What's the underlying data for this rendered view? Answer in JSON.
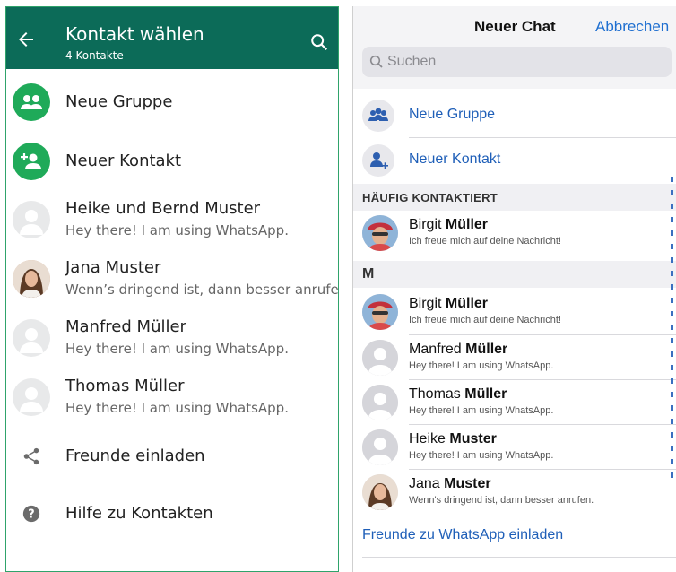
{
  "colors": {
    "android_header": "#0c6b58",
    "android_green": "#1faa59",
    "ios_blue": "#1f5fb8"
  },
  "android": {
    "title": "Kontakt wählen",
    "subtitle": "4 Kontakte",
    "actions": [
      {
        "label": "Neue Gruppe",
        "icon": "group-icon"
      },
      {
        "label": "Neuer Kontakt",
        "icon": "add-person-icon"
      }
    ],
    "contacts": [
      {
        "name": "Heike und Bernd Muster",
        "status": "Hey there! I am using WhatsApp."
      },
      {
        "name": "Jana Muster",
        "status": "Wenn’s dringend ist, dann besser anrufen."
      },
      {
        "name": "Manfred Müller",
        "status": "Hey there! I am using WhatsApp."
      },
      {
        "name": "Thomas Müller",
        "status": "Hey there! I am using WhatsApp."
      }
    ],
    "footer": [
      {
        "label": "Freunde einladen",
        "icon": "share-icon"
      },
      {
        "label": "Hilfe zu Kontakten",
        "icon": "help-icon"
      }
    ]
  },
  "ios": {
    "title": "Neuer Chat",
    "cancel": "Abbrechen",
    "search_placeholder": "Suchen",
    "actions": [
      {
        "label": "Neue Gruppe",
        "icon": "group-icon"
      },
      {
        "label": "Neuer Kontakt",
        "icon": "add-person-icon"
      }
    ],
    "frequent_header": "HÄUFIG KONTAKTIERT",
    "frequent": [
      {
        "first": "Birgit",
        "last": "Müller",
        "status": "Ich freue mich auf deine Nachricht!"
      }
    ],
    "section_letter": "M",
    "contacts": [
      {
        "first": "Birgit",
        "last": "Müller",
        "status": "Ich freue mich auf deine Nachricht!"
      },
      {
        "first": "Manfred",
        "last": "Müller",
        "status": "Hey there! I am using WhatsApp."
      },
      {
        "first": "Thomas",
        "last": "Müller",
        "status": "Hey there! I am using WhatsApp."
      },
      {
        "first": "Heike",
        "last": "Muster",
        "status": "Hey there! I am using WhatsApp."
      },
      {
        "first": "Jana",
        "last": "Muster",
        "status": "Wenn's dringend ist, dann besser anrufen."
      }
    ],
    "invite": "Freunde zu WhatsApp einladen"
  }
}
